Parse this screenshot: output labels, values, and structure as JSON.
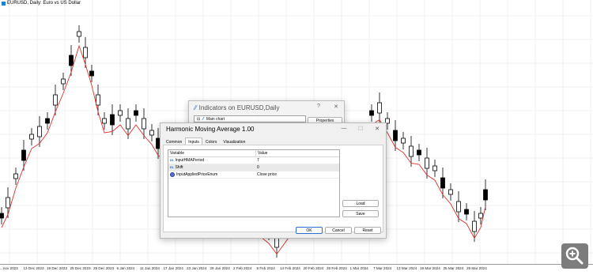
{
  "chart": {
    "title": "EURUSD, Daily:  Euro vs US Dollar",
    "xaxis_labels": [
      "...nov 2023",
      "13 Dec 2023",
      "19 Dec 2023",
      "25 Dec 2023",
      "29 Dec 2023",
      "5 Jan 2024",
      "11 Jan 2024",
      "17 Jan 2024",
      "23 Jan 2024",
      "29 Jan 2024",
      "2 Feb 2024",
      "8 Feb 2024",
      "14 Feb 2024",
      "20 Feb 2024",
      "26 Feb 2024",
      "1 Mar 2024",
      "7 Mar 2024",
      "13 Mar 2024",
      "19 Mar 2024",
      "25 Mar 2024",
      "29 Mar 2024"
    ],
    "colors": {
      "candle": "#000000",
      "ma_line": "#e0302a",
      "grid": "#e6e6e6"
    }
  },
  "indicators_window": {
    "title": "Indicators on EURUSD,Daily",
    "help_label": "?",
    "close_label": "✕",
    "tree_item": "Main chart",
    "properties_label": "Properties"
  },
  "dialog": {
    "title": "Harmonic Moving Average 1.00",
    "minimize_label": "—",
    "maximize_label": "☐",
    "close_label": "✕",
    "tabs": [
      "Common",
      "Inputs",
      "Colors",
      "Visualization"
    ],
    "active_tab": "Inputs",
    "grid": {
      "col_variable": "Variable",
      "col_value": "Value",
      "rows": [
        {
          "icon": "int-icon",
          "icon_text": "01",
          "name": "InputHMAPeriod",
          "value": "7"
        },
        {
          "icon": "int-icon",
          "icon_text": "01",
          "name": "Shift",
          "value": "0"
        },
        {
          "icon": "enum-icon",
          "icon_text": "",
          "name": "InputAppliedPriceEnum",
          "value": "Close price"
        }
      ]
    },
    "load_label": "Load",
    "save_label": "Save",
    "ok_label": "OK",
    "cancel_label": "Cancel",
    "reset_label": "Reset"
  },
  "magnifier_icon": "zoom-in-icon"
}
